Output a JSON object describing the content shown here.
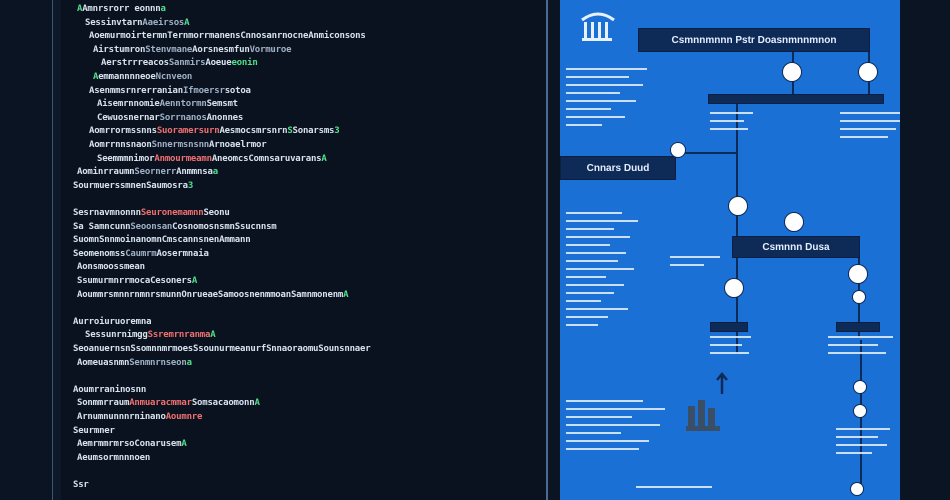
{
  "editor": {
    "lines": [
      {
        "segments": [
          {
            "t": "A",
            "c": "green"
          },
          {
            "t": "Amnrsrorr eonnn",
            "c": "white"
          },
          {
            "t": " a",
            "c": "green"
          }
        ]
      },
      {
        "segments": [
          {
            "t": "Sessinvtarn",
            "c": "white"
          },
          {
            "t": " Aaeirsos",
            "c": "dim"
          },
          {
            "t": " A",
            "c": "green"
          }
        ]
      },
      {
        "segments": [
          {
            "t": "Aoemurmoirtermn",
            "c": "white"
          },
          {
            "t": " Ternmorrmanens",
            "c": "white"
          },
          {
            "t": " Cnnosanrnocne",
            "c": "white"
          },
          {
            "t": " Anmiconsons",
            "c": "white"
          }
        ]
      },
      {
        "segments": [
          {
            "t": "Airstumron",
            "c": "white"
          },
          {
            "t": " Stenvmane",
            "c": "dim"
          },
          {
            "t": " Aorsnesmfun",
            "c": "white"
          },
          {
            "t": " Vormuroe",
            "c": "dim"
          }
        ]
      },
      {
        "segments": [
          {
            "t": "Aerstrrreacos",
            "c": "white"
          },
          {
            "t": " Sanmirs",
            "c": "dim"
          },
          {
            "t": " Aoeue",
            "c": "white"
          },
          {
            "t": " eonin",
            "c": "green"
          }
        ]
      },
      {
        "segments": [
          {
            "t": "A",
            "c": "green"
          },
          {
            "t": " emmannnneoe",
            "c": "white"
          },
          {
            "t": " Ncnveon",
            "c": "dim"
          }
        ]
      },
      {
        "segments": [
          {
            "t": "Asenmmsrnrerranian",
            "c": "white"
          },
          {
            "t": " Ifmoersr",
            "c": "dim"
          },
          {
            "t": " sotoa",
            "c": "white"
          }
        ]
      },
      {
        "segments": [
          {
            "t": "Aisemrnnomie",
            "c": "white"
          },
          {
            "t": " Aenntormn",
            "c": "dim"
          },
          {
            "t": " Semsmt",
            "c": "white"
          }
        ]
      },
      {
        "segments": [
          {
            "t": "Cewuosnernar",
            "c": "white"
          },
          {
            "t": " Sorrnanos",
            "c": "dim"
          },
          {
            "t": " Anonnes",
            "c": "white"
          }
        ]
      },
      {
        "segments": [
          {
            "t": "Aomrrormssnns",
            "c": "white"
          },
          {
            "t": " Suoramersurn",
            "c": "red"
          },
          {
            "t": " Aesmocsmrsnrn",
            "c": "white"
          },
          {
            "t": " S",
            "c": "green"
          },
          {
            "t": " Sonarsms",
            "c": "white"
          },
          {
            "t": " 3",
            "c": "green"
          }
        ]
      },
      {
        "segments": [
          {
            "t": "Aomrrnnsnaon",
            "c": "white"
          },
          {
            "t": " Snnermsnsnn",
            "c": "dim"
          },
          {
            "t": " Arnoaelrmor",
            "c": "white"
          }
        ]
      },
      {
        "segments": [
          {
            "t": "Seemmmnimor",
            "c": "white"
          },
          {
            "t": " Anmourmeamn",
            "c": "red"
          },
          {
            "t": " Aneomcs",
            "c": "white"
          },
          {
            "t": " Comnsaruvarans",
            "c": "white"
          },
          {
            "t": " A",
            "c": "green"
          }
        ]
      },
      {
        "segments": [
          {
            "t": "Aominrraumn",
            "c": "white"
          },
          {
            "t": " Seornerr",
            "c": "dim"
          },
          {
            "t": " Anmmnsa",
            "c": "white"
          },
          {
            "t": " a",
            "c": "green"
          }
        ]
      },
      {
        "segments": [
          {
            "t": "Sourmuerssmnen",
            "c": "white"
          },
          {
            "t": " Saumosra",
            "c": "white"
          },
          {
            "t": " 3",
            "c": "green"
          }
        ]
      },
      {
        "segments": [
          {
            "t": "",
            "c": "white"
          }
        ]
      },
      {
        "segments": [
          {
            "t": "Sesrnavmnonnn",
            "c": "white"
          },
          {
            "t": " Seuronemamnn",
            "c": "red"
          },
          {
            "t": " Seonu",
            "c": "white"
          }
        ]
      },
      {
        "segments": [
          {
            "t": "Sa Samncunn",
            "c": "white"
          },
          {
            "t": " Seoonsan",
            "c": "dim"
          },
          {
            "t": " Cosnomosnsmn",
            "c": "white"
          },
          {
            "t": " Ssucnnsm",
            "c": "white"
          }
        ]
      },
      {
        "segments": [
          {
            "t": "Suomn",
            "c": "white"
          },
          {
            "t": " Snnmoinanomn",
            "c": "white"
          },
          {
            "t": " Cmscannsnen",
            "c": "white"
          },
          {
            "t": " Ammann",
            "c": "white"
          }
        ]
      },
      {
        "segments": [
          {
            "t": "Seomenomss",
            "c": "white"
          },
          {
            "t": " Caumrm",
            "c": "dim"
          },
          {
            "t": " Aosermnaia",
            "c": "white"
          }
        ]
      },
      {
        "segments": [
          {
            "t": "Aonsmoossmean",
            "c": "white"
          }
        ]
      },
      {
        "segments": [
          {
            "t": "Ssumurmnrrmoca",
            "c": "white"
          },
          {
            "t": " Cesoners",
            "c": "white"
          },
          {
            "t": " A",
            "c": "green"
          }
        ]
      },
      {
        "segments": [
          {
            "t": "Aoummrsmnnrnmnrsmunn",
            "c": "white"
          },
          {
            "t": " Onrueae",
            "c": "white"
          },
          {
            "t": " Samoosnenmmoan",
            "c": "white"
          },
          {
            "t": " Samnmonenm",
            "c": "white"
          },
          {
            "t": " A",
            "c": "green"
          }
        ]
      },
      {
        "segments": [
          {
            "t": "",
            "c": "white"
          }
        ]
      },
      {
        "segments": [
          {
            "t": "Aurroiuruoremn",
            "c": "white"
          },
          {
            "t": " a",
            "c": "white"
          }
        ]
      },
      {
        "segments": [
          {
            "t": "Sessunrnimgg",
            "c": "white"
          },
          {
            "t": " Ssremrnranma",
            "c": "red"
          },
          {
            "t": " A",
            "c": "green"
          }
        ]
      },
      {
        "segments": [
          {
            "t": "Seoanuernsn",
            "c": "white"
          },
          {
            "t": " Ssomnnmrmoes",
            "c": "white"
          },
          {
            "t": " Ssounurmeanurf",
            "c": "white"
          },
          {
            "t": " Snnaoraomu",
            "c": "white"
          },
          {
            "t": " Sounsnnaer",
            "c": "white"
          }
        ]
      },
      {
        "segments": [
          {
            "t": "Aomeuasnmn",
            "c": "white"
          },
          {
            "t": " Senmnrnseon",
            "c": "dim"
          },
          {
            "t": " a",
            "c": "green"
          }
        ]
      },
      {
        "segments": [
          {
            "t": "",
            "c": "white"
          }
        ]
      },
      {
        "segments": [
          {
            "t": "Aoumrraninosnn",
            "c": "white"
          }
        ]
      },
      {
        "segments": [
          {
            "t": "Sonmmrraum",
            "c": "white"
          },
          {
            "t": " Anmuaracmmar",
            "c": "red"
          },
          {
            "t": " Somsacaomonn",
            "c": "white"
          },
          {
            "t": " A",
            "c": "green"
          }
        ]
      },
      {
        "segments": [
          {
            "t": "Arnumnunnnrninano",
            "c": "white"
          },
          {
            "t": " Aoumnre",
            "c": "red"
          }
        ]
      },
      {
        "segments": [
          {
            "t": "Seurmner",
            "c": "white"
          }
        ]
      },
      {
        "segments": [
          {
            "t": "Aemrmmrmrso",
            "c": "white"
          },
          {
            "t": " Conarusem",
            "c": "white"
          },
          {
            "t": " A",
            "c": "green"
          }
        ]
      },
      {
        "segments": [
          {
            "t": "Aeumsormnnnoen",
            "c": "white"
          }
        ]
      },
      {
        "segments": [
          {
            "t": "",
            "c": "white"
          }
        ]
      },
      {
        "segments": [
          {
            "t": "Ssr",
            "c": "white"
          }
        ]
      }
    ]
  },
  "diagram": {
    "header_box": "Csmnnmnnn Pstr Doasnmnnmnon",
    "left_box": "Cnnars Duud",
    "mid_box": "Csmnnn Dusa"
  }
}
